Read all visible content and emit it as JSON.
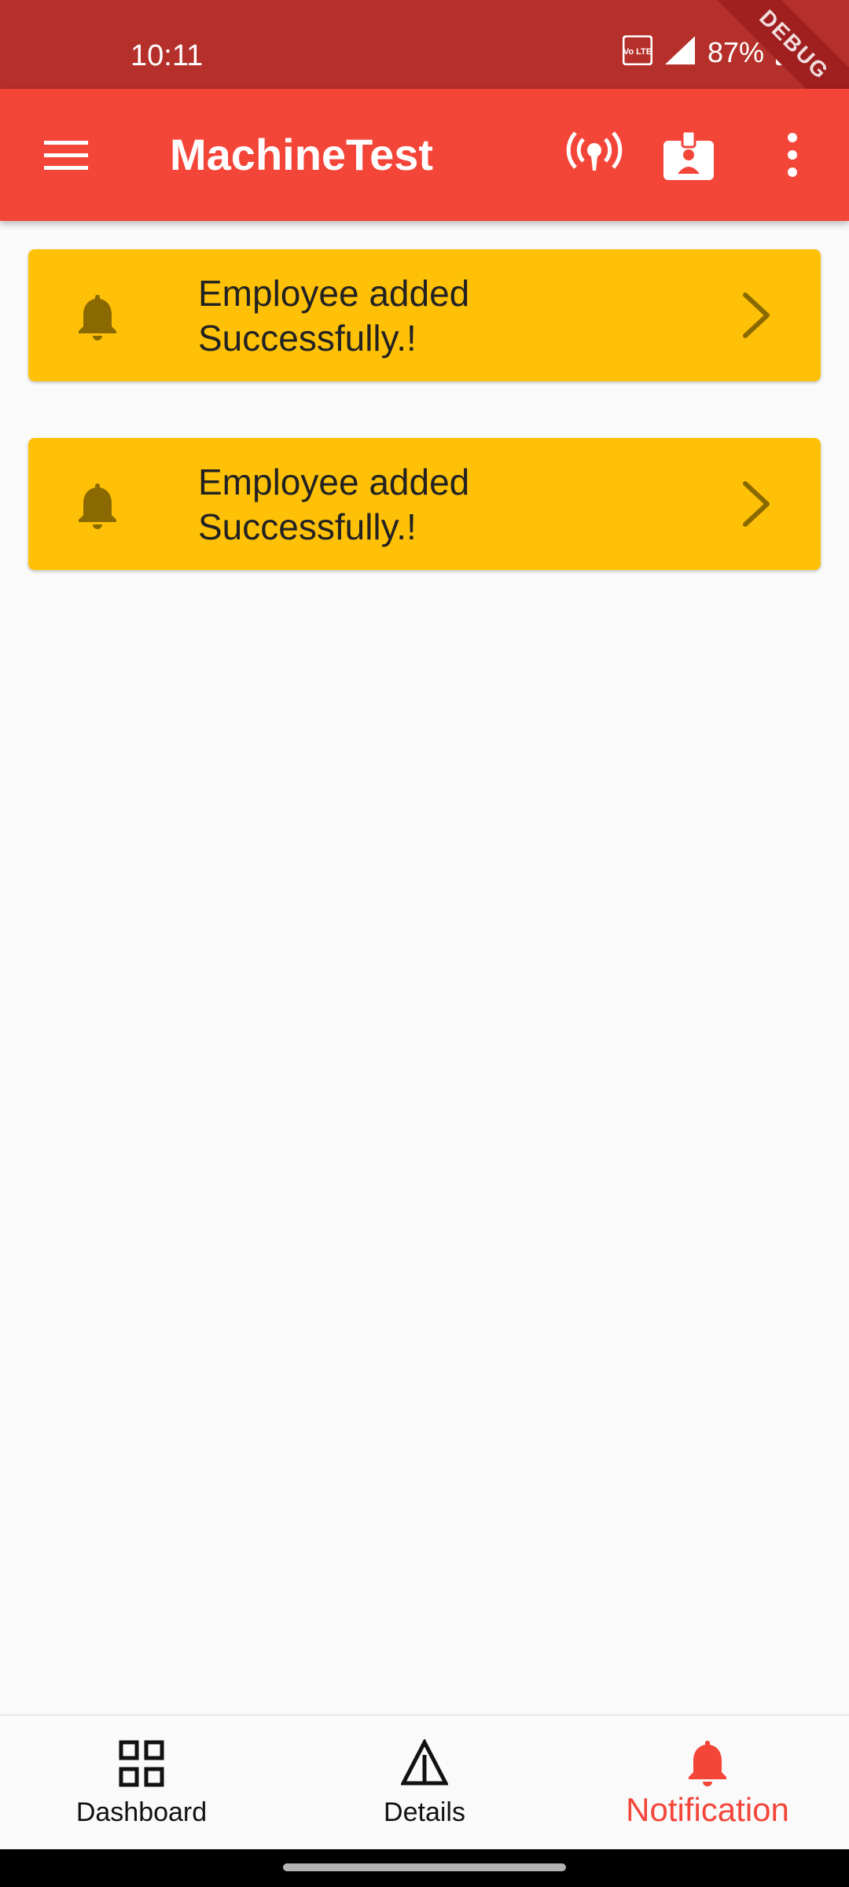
{
  "status_bar": {
    "time": "10:11",
    "battery_text": "87%",
    "network_badge": "Vo LTE",
    "icons": [
      "volte-icon",
      "signal-icon",
      "battery-icon"
    ],
    "ribbon_text": "DEBUG"
  },
  "app_bar": {
    "title": "MachineTest",
    "actions": [
      "broadcast-icon",
      "id-badge-icon",
      "more-vert-icon"
    ],
    "color": "#f44539"
  },
  "notifications": [
    {
      "message_line1": "Employee added",
      "message_line2": "Successfully.!"
    },
    {
      "message_line1": "Employee added",
      "message_line2": "Successfully.!"
    }
  ],
  "card_color": "#ffc107",
  "bottom_nav": {
    "items": [
      {
        "label": "Dashboard",
        "icon": "dashboard-grid-icon",
        "active": false
      },
      {
        "label": "Details",
        "icon": "warning-triangle-icon",
        "active": false
      },
      {
        "label": "Notification",
        "icon": "bell-icon",
        "active": true
      }
    ],
    "active_color": "#f44539"
  }
}
